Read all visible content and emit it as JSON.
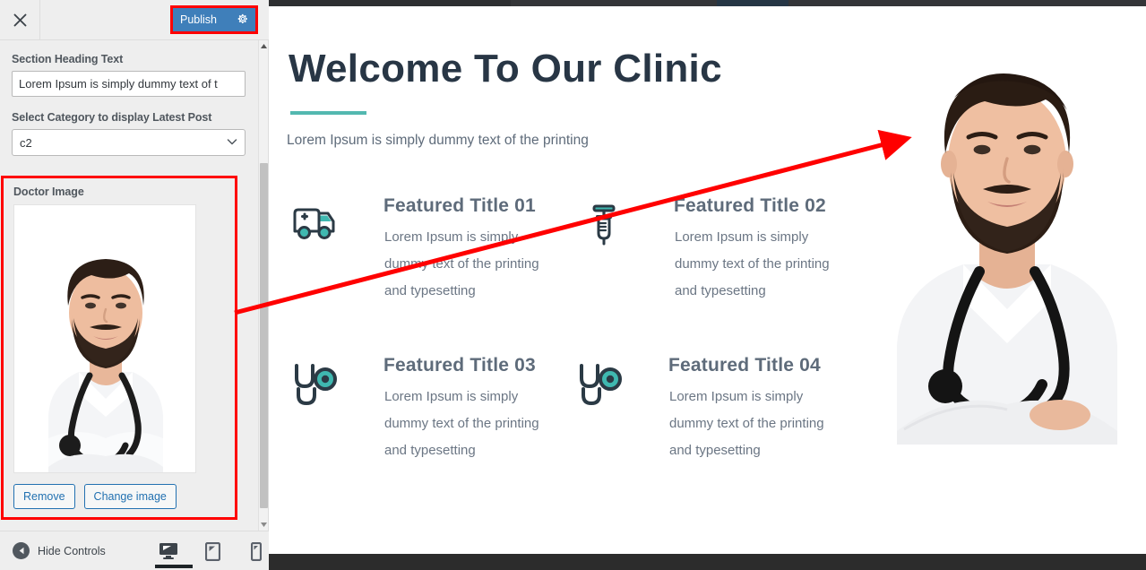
{
  "customizer": {
    "close_icon": "close-icon",
    "publish_label": "Publish",
    "publish_gear_icon": "gear-icon",
    "fields": {
      "heading_label": "Section Heading Text",
      "heading_value": "Lorem Ipsum is simply dummy text of t",
      "heading_placeholder": "Section Heading Text",
      "category_label": "Select Category to display Latest Post",
      "category_value": "c2",
      "category_options": [
        "c2"
      ],
      "image_label": "Doctor Image",
      "remove_label": "Remove",
      "change_label": "Change image"
    },
    "footer": {
      "hide_controls_label": "Hide Controls",
      "devices": [
        {
          "name": "desktop-preview-button",
          "icon": "desktop-icon",
          "active": true
        },
        {
          "name": "tablet-preview-button",
          "icon": "tablet-icon",
          "active": false
        },
        {
          "name": "mobile-preview-button",
          "icon": "mobile-icon",
          "active": false
        }
      ]
    },
    "highlight_color": "#ff0000",
    "accent_color": "#3f7fba"
  },
  "preview": {
    "hero": {
      "title": "Welcome To Our Clinic",
      "subtitle": "Lorem Ipsum is simply dummy text of the printing",
      "rule_color": "#53b8b0",
      "title_color": "#283645"
    },
    "features": [
      {
        "icon": "ambulance-icon",
        "title": "Featured Title 01",
        "text": "Lorem Ipsum is simply dummy text of the printing and typesetting"
      },
      {
        "icon": "syringe-icon",
        "title": "Featured Title 02",
        "text": "Lorem Ipsum is simply dummy text of the printing and typesetting"
      },
      {
        "icon": "stethoscope-icon",
        "title": "Featured Title 03",
        "text": "Lorem Ipsum is simply dummy text of the printing and typesetting"
      },
      {
        "icon": "stethoscope-icon",
        "title": "Featured Title 04",
        "text": "Lorem Ipsum is simply dummy text of the printing and typesetting"
      }
    ],
    "doctor_image_alt": "doctor-photo"
  }
}
